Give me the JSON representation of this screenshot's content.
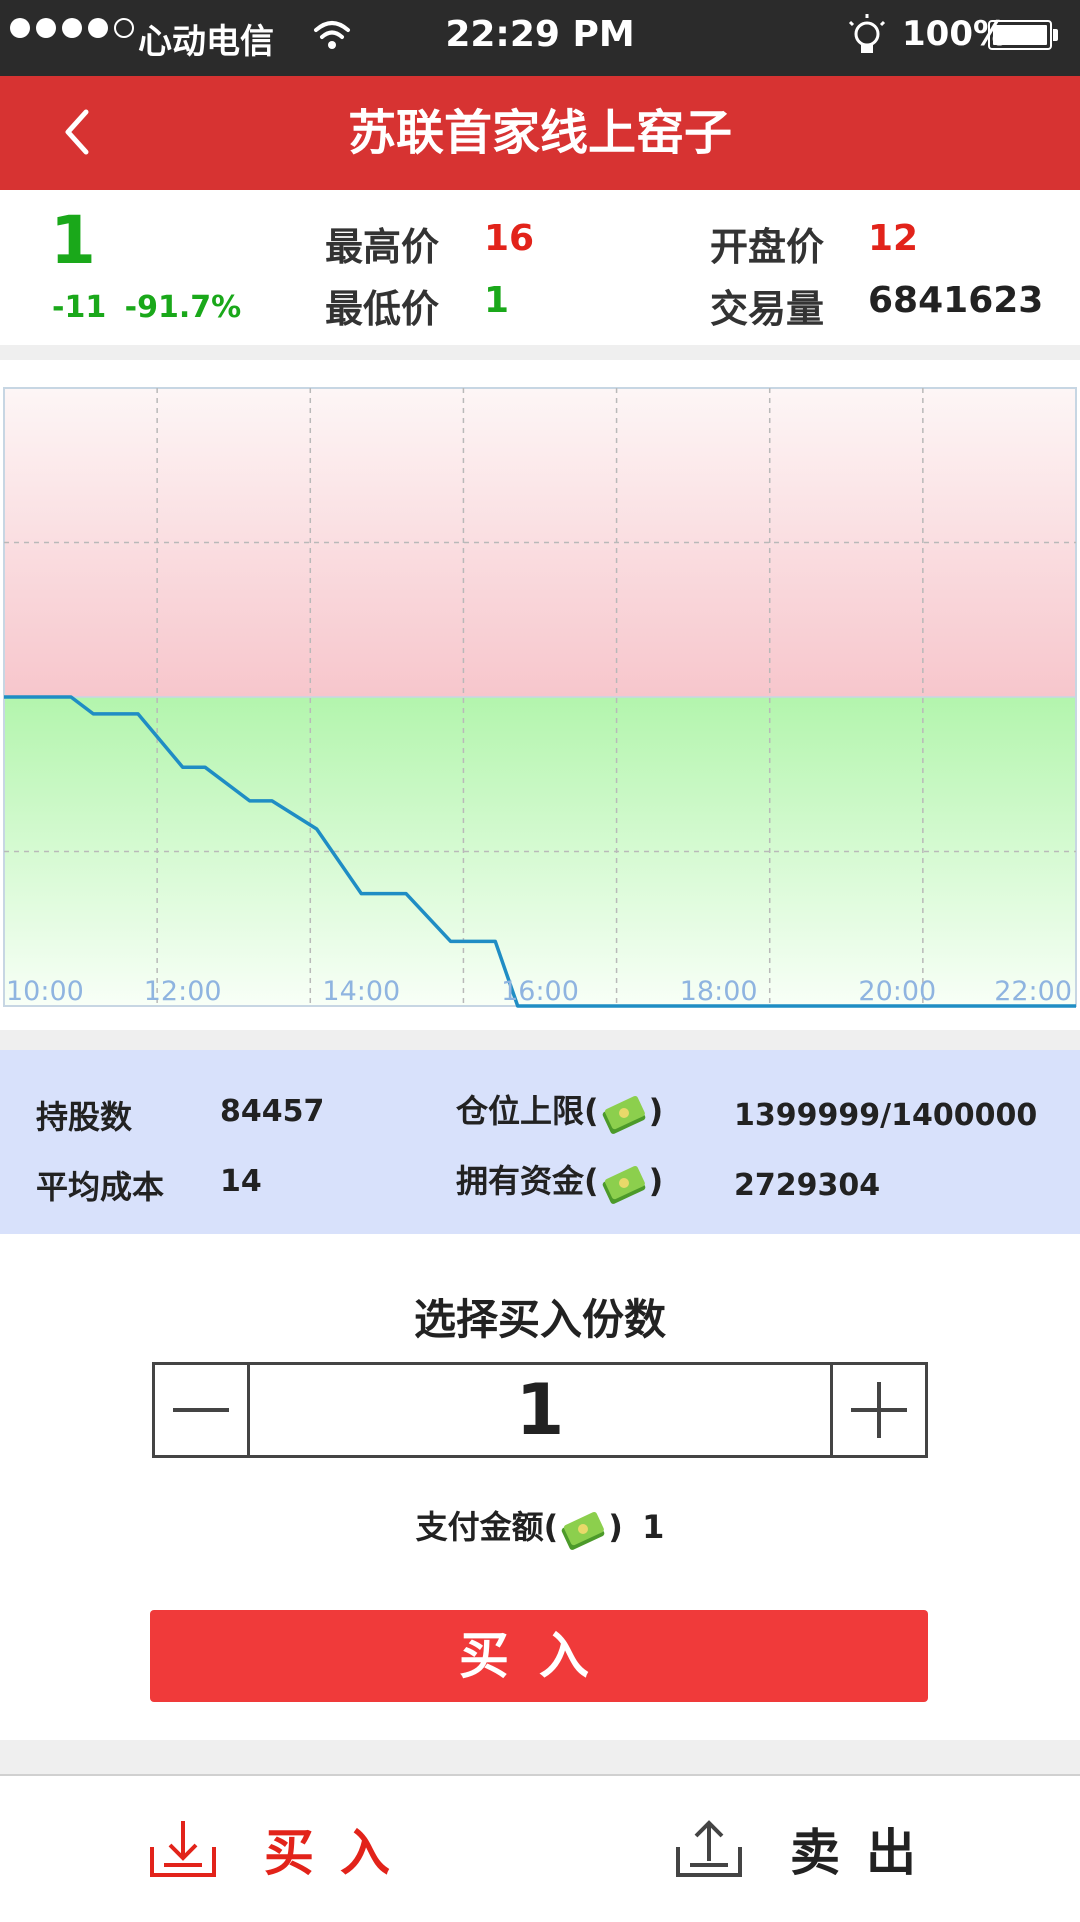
{
  "status": {
    "carrier": "心动电信",
    "time": "22:29 PM",
    "battery": "100%"
  },
  "nav": {
    "title": "苏联首家线上窑子"
  },
  "price": {
    "current": "1",
    "change": "-11",
    "change_pct": "-91.7%",
    "high_label": "最高价",
    "high": "16",
    "low_label": "最低价",
    "low": "1",
    "open_label": "开盘价",
    "open": "12",
    "volume_label": "交易量",
    "volume": "6841623"
  },
  "chart_data": {
    "type": "line",
    "x_ticks": [
      "10:00",
      "12:00",
      "14:00",
      "16:00",
      "18:00",
      "20:00",
      "22:00"
    ],
    "x_start": "10:00",
    "x_end": "22:00",
    "reference_price": 12,
    "ylim": [
      1,
      23
    ],
    "grid": true,
    "colors": {
      "line": "#1f8dc4",
      "above": "#f7c6cc",
      "below": "#b3f5ad"
    },
    "series": [
      {
        "x": [
          "10:00",
          "10:45",
          "11:00",
          "11:30",
          "12:00",
          "12:15",
          "12:45",
          "13:00",
          "13:30",
          "14:00",
          "14:30",
          "15:00",
          "15:30",
          "15:45",
          "16:00",
          "22:00"
        ],
        "values": [
          12,
          12,
          11.4,
          11.4,
          9.5,
          9.5,
          8.3,
          8.3,
          7.3,
          5.0,
          5.0,
          3.3,
          3.3,
          1.0,
          1.0,
          1.0
        ]
      }
    ]
  },
  "holdings": {
    "shares_label": "持股数",
    "shares": "84457",
    "cap_label": "仓位上限(",
    "cap_close": ")",
    "cap": "1399999/1400000",
    "cost_label": "平均成本",
    "cost": "14",
    "funds_label": "拥有资金(",
    "funds_close": ")",
    "funds": "2729304"
  },
  "buy": {
    "heading": "选择买入份数",
    "quantity": "1",
    "pay_label": "支付金额(",
    "pay_close": ")",
    "pay_amount": "1",
    "button": "买入"
  },
  "tabs": {
    "buy": "买入",
    "sell": "卖出"
  },
  "colors": {
    "brand_red": "#d73332",
    "up_red": "#e2231a",
    "down_green": "#1aa81a",
    "button_red": "#f03a3a"
  }
}
